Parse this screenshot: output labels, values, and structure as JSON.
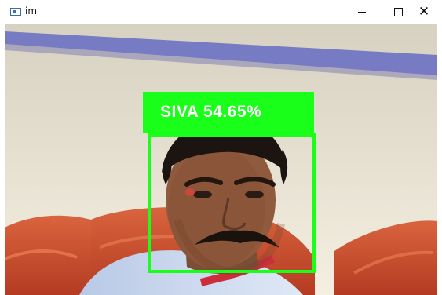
{
  "window": {
    "title": "im"
  },
  "controls": {
    "minimize": "minimize-icon",
    "maximize": "maximize-icon",
    "close": "close-icon"
  },
  "detection": {
    "label": "SIVA 54.65%"
  }
}
